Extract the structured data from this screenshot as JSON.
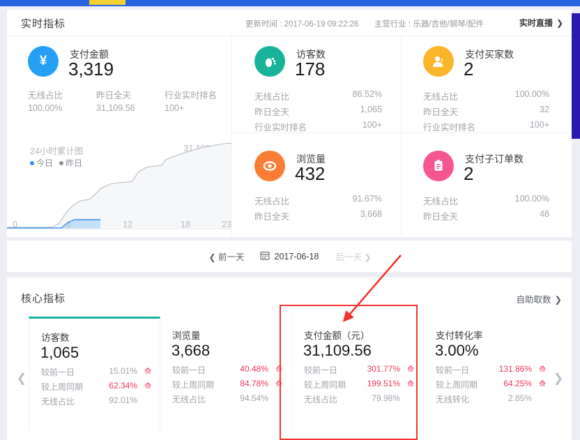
{
  "topbar": {
    "tab_marker": ""
  },
  "realtime": {
    "title": "实时指标",
    "update_label": "更新时间 :",
    "update_time": "2017-06-19 09:22:26",
    "industry_label": "主营行业 :",
    "industry_value": "乐器/吉他/钢琴/配件",
    "live_label": "实时直播",
    "live_chevron": "❯",
    "metrics": [
      {
        "icon": "yuan-icon",
        "glyph": "¥",
        "color": "#26a0f5",
        "name": "支付金额",
        "value": "3,319",
        "layout": "wide",
        "row_labels": [
          "无线占比",
          "昨日全天",
          "行业实时排名"
        ],
        "row_values": [
          "100.00%",
          "31,109.56",
          "100+"
        ]
      },
      {
        "icon": "footprint-icon",
        "glyph": "footprint",
        "color": "#19b39b",
        "name": "访客数",
        "value": "178",
        "layout": "stack",
        "rows": [
          {
            "label": "无线占比",
            "value": "86.52%"
          },
          {
            "label": "昨日全天",
            "value": "1,065"
          },
          {
            "label": "行业实时排名",
            "value": "100+"
          }
        ]
      },
      {
        "icon": "user-icon",
        "glyph": "user",
        "color": "#fbb52b",
        "name": "支付买家数",
        "value": "2",
        "layout": "stack",
        "rows": [
          {
            "label": "无线占比",
            "value": "100.00%"
          },
          {
            "label": "昨日全天",
            "value": "32"
          },
          {
            "label": "行业实时排名",
            "value": "100+"
          }
        ]
      },
      {
        "icon": "eye-icon",
        "glyph": "eye",
        "color": "#f97d34",
        "name": "浏览量",
        "value": "432",
        "layout": "stack",
        "rows": [
          {
            "label": "无线占比",
            "value": "91.67%"
          },
          {
            "label": "昨日全天",
            "value": "3,668"
          }
        ]
      },
      {
        "icon": "clipboard-icon",
        "glyph": "clipboard",
        "color": "#f6568f",
        "name": "支付子订单数",
        "value": "2",
        "layout": "stack",
        "rows": [
          {
            "label": "无线占比",
            "value": "100.00%"
          },
          {
            "label": "昨日全天",
            "value": "48"
          }
        ]
      }
    ]
  },
  "chart_data": {
    "type": "area",
    "title": "24小时累计图",
    "max_label": "31,109.56",
    "xlabel": "",
    "ylabel": "",
    "grid": false,
    "legend_position": "top-left",
    "legend": [
      {
        "name": "今日",
        "color": "#2f8ff0"
      },
      {
        "name": "昨日",
        "color": "#8c9199"
      }
    ],
    "xticks": [
      "0",
      "6",
      "12",
      "18",
      "23"
    ],
    "x": [
      0,
      1,
      2,
      3,
      4,
      5,
      6,
      7,
      8,
      9,
      10,
      11,
      12,
      13,
      14,
      15,
      16,
      17,
      18,
      19,
      20,
      21,
      22,
      23
    ],
    "ylim": [
      0,
      31109.56
    ],
    "series": [
      {
        "name": "昨日",
        "color": "#8c9199",
        "values": [
          0,
          0,
          0,
          0,
          0,
          0,
          60,
          1100,
          3500,
          5400,
          6000,
          6600,
          9000,
          11500,
          12000,
          12200,
          12300,
          15500,
          17800,
          18000,
          21800,
          24500,
          27500,
          31109.56
        ]
      },
      {
        "name": "今日",
        "color": "#2f8ff0",
        "values": [
          0,
          0,
          0,
          0,
          0,
          0,
          40,
          3319,
          3319,
          null,
          null,
          null,
          null,
          null,
          null,
          null,
          null,
          null,
          null,
          null,
          null,
          null,
          null,
          null
        ]
      }
    ]
  },
  "date_nav": {
    "prev_label": "前一天",
    "prev_chevron": "❮",
    "calendar_icon": "calendar-icon",
    "date": "2017-06-18",
    "next_label": "后一天",
    "next_chevron": "❯"
  },
  "core": {
    "title": "核心指标",
    "link_label": "自助取数",
    "link_chevron": "❯",
    "arrow_left": "❮",
    "arrow_right": "❯",
    "accent_color": "#19b39b",
    "up_color": "#f0365e",
    "cards": [
      {
        "name": "访客数",
        "value": "1,065",
        "active": true,
        "rows": [
          {
            "label": "较前一日",
            "value": "15.01%",
            "trend": "up",
            "value_colored": false
          },
          {
            "label": "较上周同期",
            "value": "62.34%",
            "trend": "up",
            "value_colored": true
          },
          {
            "label": "无线占比",
            "value": "92.01%",
            "trend": "",
            "value_colored": false
          }
        ]
      },
      {
        "name": "浏览量",
        "value": "3,668",
        "active": false,
        "rows": [
          {
            "label": "较前一日",
            "value": "40.48%",
            "trend": "up",
            "value_colored": true
          },
          {
            "label": "较上周同期",
            "value": "84.78%",
            "trend": "up",
            "value_colored": true
          },
          {
            "label": "无线占比",
            "value": "94.54%",
            "trend": "",
            "value_colored": false
          }
        ]
      },
      {
        "name": "支付金额（元）",
        "value": "31,109.56",
        "active": false,
        "highlighted": true,
        "rows": [
          {
            "label": "较前一日",
            "value": "301.77%",
            "trend": "up",
            "value_colored": true
          },
          {
            "label": "较上周同期",
            "value": "199.51%",
            "trend": "up",
            "value_colored": true
          },
          {
            "label": "无线占比",
            "value": "79.98%",
            "trend": "",
            "value_colored": false
          }
        ]
      },
      {
        "name": "支付转化率",
        "value": "3.00%",
        "active": false,
        "rows": [
          {
            "label": "较前一日",
            "value": "131.86%",
            "trend": "up",
            "value_colored": true
          },
          {
            "label": "较上周同期",
            "value": "64.25%",
            "trend": "up",
            "value_colored": true
          },
          {
            "label": "无线转化",
            "value": "2.85%",
            "trend": "",
            "value_colored": false
          }
        ]
      }
    ]
  },
  "annotation": {
    "shape": "red-rectangle-and-arrow",
    "color": "#f3332f"
  }
}
